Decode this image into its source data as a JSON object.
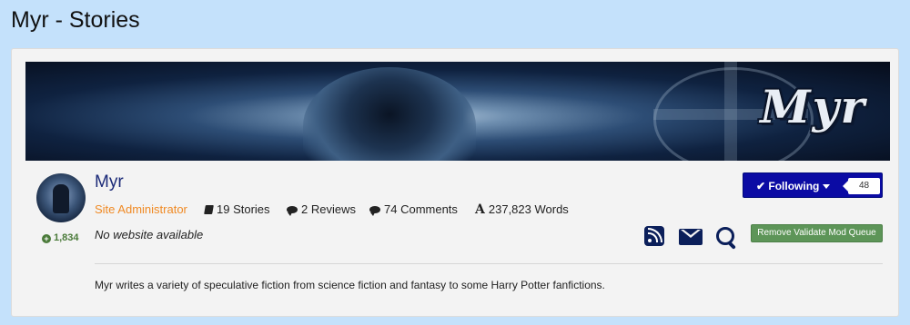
{
  "page": {
    "title": "Myr - Stories"
  },
  "banner": {
    "logo_text": "Myr"
  },
  "profile": {
    "username": "Myr",
    "role": "Site Administrator",
    "reputation": "1,834",
    "stats": {
      "stories": "19 Stories",
      "reviews": "2 Reviews",
      "comments": "74 Comments",
      "words": "237,823 Words"
    },
    "website": "No website available",
    "bio": "Myr writes a variety of speculative fiction from science fiction and fantasy to some Harry Potter fanfictions."
  },
  "actions": {
    "following_label": "Following",
    "followers_count": "48",
    "mod_button_label": "Remove Validate Mod Queue"
  },
  "icons": {
    "stories": "book-icon",
    "reviews": "comment-icon",
    "comments": "comment-icon",
    "words": "font-icon",
    "rss": "rss-icon",
    "message": "envelope-icon",
    "search": "search-icon",
    "check": "check-icon",
    "caret": "caret-down-icon"
  },
  "colors": {
    "background": "#c4e1fb",
    "username": "#1b2a78",
    "role": "#f08a24",
    "follow_button": "#0b0ba4",
    "mod_button": "#5d9558",
    "reputation": "#4a7a39"
  }
}
